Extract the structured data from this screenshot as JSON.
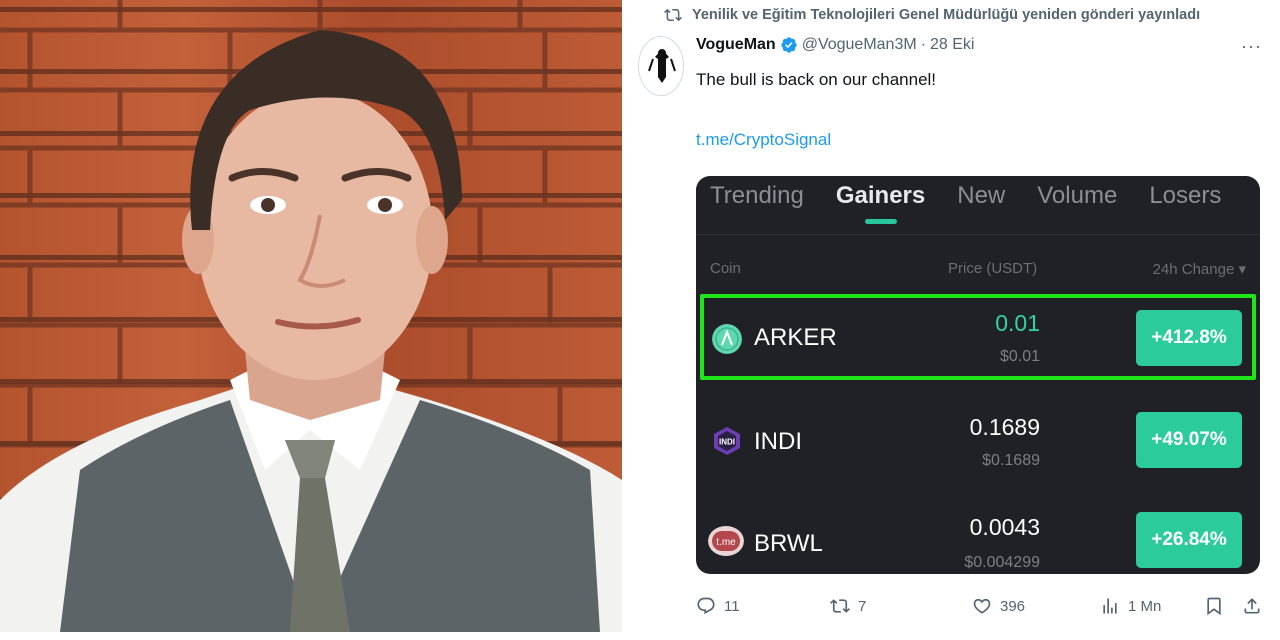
{
  "photo": {
    "description_icon": "portrait-photo"
  },
  "tweet": {
    "repost_text": "Yenilik ve Eğitim Teknolojileri Genel Müdürlüğü yeniden gönderi yayınladı",
    "author_name": "VogueMan",
    "handle": "@VogueMan3M",
    "separator": "·",
    "date": "28 Eki",
    "more": "···",
    "text": "The bull is back on our channel!",
    "link": "t.me/CryptoSignal",
    "colors": {
      "link": "#1d9bf0",
      "verified": "#1d9bf0",
      "muted": "#536471"
    }
  },
  "card": {
    "tabs": [
      {
        "label": "Trending",
        "active": false
      },
      {
        "label": "Gainers",
        "active": true
      },
      {
        "label": "New",
        "active": false
      },
      {
        "label": "Volume",
        "active": false
      },
      {
        "label": "Losers",
        "active": false
      }
    ],
    "columns": {
      "coin": "Coin",
      "price": "Price (USDT)",
      "change": "24h Change ▾"
    },
    "rows": [
      {
        "coin": "ARKER",
        "price": "0.01",
        "price_usd": "$0.01",
        "change": "+412.8%",
        "icon": "arker-coin-icon",
        "highlighted": true
      },
      {
        "coin": "INDI",
        "price": "0.1689",
        "price_usd": "$0.1689",
        "change": "+49.07%",
        "icon": "indi-coin-icon",
        "highlighted": false
      },
      {
        "coin": "BRWL",
        "price": "0.0043",
        "price_usd": "$0.004299",
        "change": "+26.84%",
        "icon": "brwl-coin-icon",
        "highlighted": false
      }
    ],
    "colors": {
      "background": "#1f2126",
      "accent": "#2bcb9b",
      "highlight": "#1fe61a"
    }
  },
  "actions": {
    "replies": "11",
    "reposts": "7",
    "likes": "396",
    "views": "1 Mn"
  }
}
